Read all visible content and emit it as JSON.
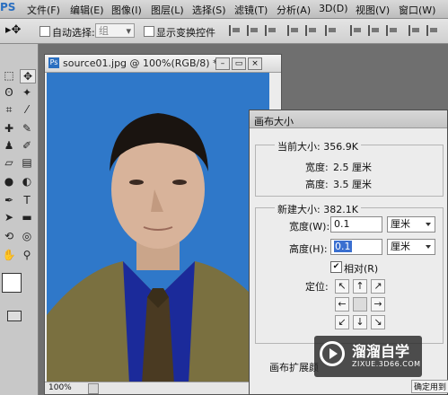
{
  "app": {
    "logo": "PS"
  },
  "menu": [
    "文件(F)",
    "编辑(E)",
    "图像(I)",
    "图层(L)",
    "选择(S)",
    "滤镜(T)",
    "分析(A)",
    "3D(D)",
    "视图(V)",
    "窗口(W)"
  ],
  "options_bar": {
    "auto_select_label": "自动选择:",
    "auto_select_value": "组",
    "transform_controls_label": "显示变换控件"
  },
  "document": {
    "title": "source01.jpg @ 100%(RGB/8) *",
    "zoom": "100%",
    "minimize": "–",
    "restore": "▭",
    "close": "×"
  },
  "dialog": {
    "title": "画布大小",
    "current_size_label": "当前大小: 356.9K",
    "current_width_label": "宽度:",
    "current_width_value": "2.5 厘米",
    "current_height_label": "高度:",
    "current_height_value": "3.5 厘米",
    "new_size_label": "新建大小: 382.1K",
    "width_label": "宽度(W):",
    "width_value": "0.1",
    "width_unit": "厘米",
    "height_label": "高度(H):",
    "height_value": "0.1",
    "height_unit": "厘米",
    "relative_label": "相对(R)",
    "anchor_label": "定位:",
    "anchor_arrows": [
      "↖",
      "↑",
      "↗",
      "←",
      "",
      "→",
      "↙",
      "↓",
      "↘"
    ],
    "extension_color_label": "画布扩展颜",
    "ok_button_partial": "确定用到"
  },
  "watermark": {
    "brand": "溜溜自学",
    "url": "ZIXUE.3D66.COM"
  },
  "colors": {
    "background_blue": "#2f78c9",
    "suit_olive": "#7a7040",
    "shirt_blue": "#1b2a9a"
  }
}
